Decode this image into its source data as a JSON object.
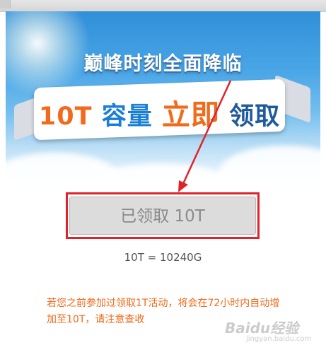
{
  "banner": {
    "headline": "巅峰时刻全面降临",
    "ribbon": {
      "part1": "10T",
      "part2": "容量",
      "part3": "立即",
      "part4": "领取"
    }
  },
  "claim": {
    "button_label": "已领取 10T"
  },
  "capacity_text": "10T = 10240G",
  "notice_text": "若您之前参加过领取1T活动，将会在72小时内自动增加至10T，请注意查收",
  "watermark": {
    "text": "Baidu经验",
    "sub": "jingyan.baidu.com"
  },
  "colors": {
    "accent_orange": "#f26a1b",
    "highlight_red": "#e1222a",
    "brand_blue": "#1a7ed6"
  }
}
